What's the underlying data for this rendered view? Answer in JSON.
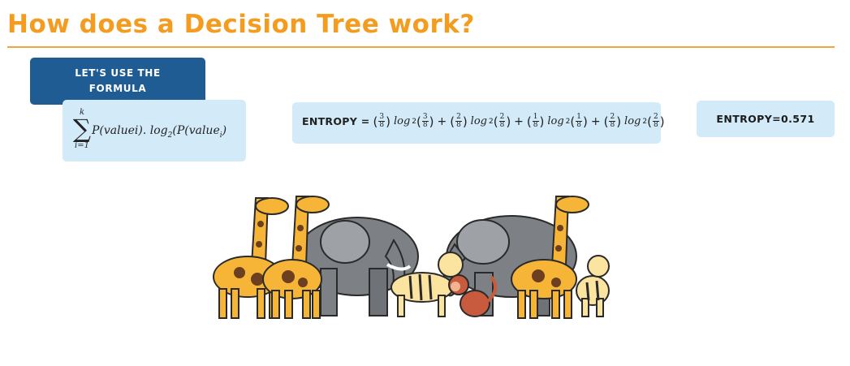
{
  "slide": {
    "title": "How does a Decision Tree work?",
    "badge_line1": "LET'S USE THE",
    "badge_line2": "FORMULA"
  },
  "formula": {
    "sum_upper": "k",
    "sum_lower": "i=1",
    "sum_symbol": "∑",
    "body_part1": "P(valuei). log",
    "body_sub1": "2",
    "body_part2": "(P(value",
    "body_sub2": "i",
    "body_part3": ")"
  },
  "entropy": {
    "label": "ENTROPY =",
    "log": "log",
    "log_base": "2",
    "terms": [
      {
        "num": "3",
        "den": "8"
      },
      {
        "num": "2",
        "den": "8"
      },
      {
        "num": "1",
        "den": "8"
      },
      {
        "num": "2",
        "den": "8"
      }
    ],
    "operators": [
      "+",
      "+",
      "+"
    ]
  },
  "result": {
    "text": "ENTROPY=0.571"
  },
  "illustration": {
    "icon": "zoo-animals-illustration",
    "colors": {
      "giraffe": "#f7b538",
      "giraffe_spots": "#6b3f1f",
      "elephant": "#7d8185",
      "tiger": "#fbe3a0",
      "monkey": "#c85a3d",
      "outline": "#2a2a2a"
    }
  },
  "theme": {
    "title_color": "#f39c1f",
    "badge_color": "#1f5c93",
    "box_color": "#d3ebf8"
  }
}
